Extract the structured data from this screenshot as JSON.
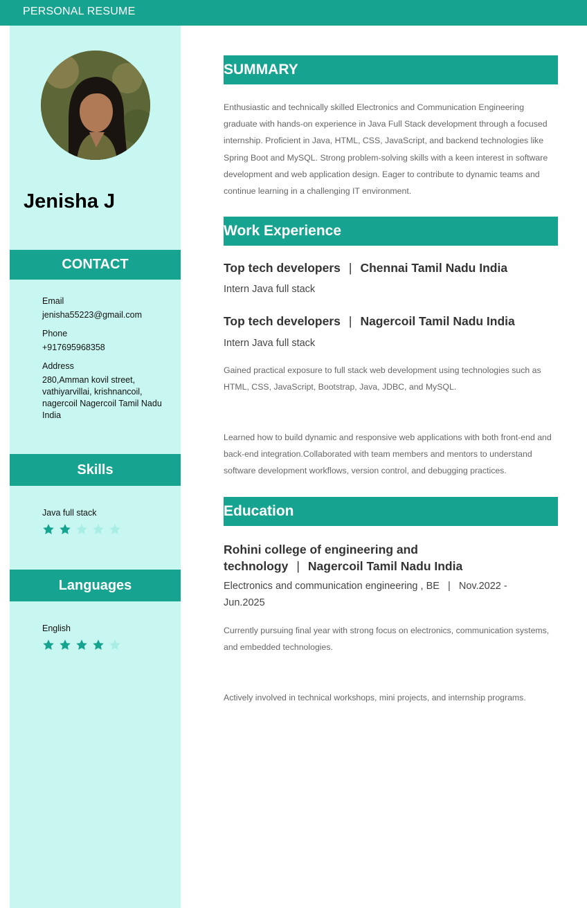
{
  "header": {
    "title": "PERSONAL RESUME"
  },
  "profile": {
    "name": "Jenisha J"
  },
  "contact": {
    "heading": "CONTACT",
    "email_label": "Email",
    "email": "jenisha55223@gmail.com",
    "phone_label": "Phone",
    "phone": "+917695968358",
    "address_label": "Address",
    "address": "280,Amman kovil street, vathiyarvillai, krishnancoil, nagercoil Nagercoil Tamil Nadu India"
  },
  "skills": {
    "heading": "Skills",
    "items": [
      {
        "name": "Java full stack",
        "rating": 2,
        "max": 5
      }
    ]
  },
  "languages": {
    "heading": "Languages",
    "items": [
      {
        "name": "English",
        "rating": 4,
        "max": 5
      }
    ]
  },
  "summary": {
    "heading": "SUMMARY",
    "text": "Enthusiastic and technically skilled Electronics and Communication Engineering graduate with hands-on experience in Java Full Stack development through a focused internship. Proficient in Java, HTML, CSS, JavaScript, and backend technologies like Spring Boot and MySQL. Strong problem-solving skills with a keen interest in software development and web application design. Eager to contribute to dynamic teams and continue learning in a challenging IT environment."
  },
  "work": {
    "heading": "Work Experience",
    "jobs": [
      {
        "company": "Top tech developers",
        "separator": "|",
        "location": "Chennai Tamil Nadu India",
        "role": "Intern Java full stack"
      },
      {
        "company": "Top tech developers",
        "separator": "|",
        "location": "Nagercoil Tamil Nadu India",
        "role": "Intern Java full stack"
      }
    ],
    "desc1": "Gained practical exposure to full stack web development using technologies such as HTML, CSS, JavaScript, Bootstrap, Java, JDBC, and MySQL.",
    "desc2": "Learned how to build dynamic and responsive web applications with both front-end and back-end integration.Collaborated with team members and mentors to understand software development workflows, version control, and debugging practices."
  },
  "education": {
    "heading": "Education",
    "school": "Rohini college of engineering and technology",
    "separator": "|",
    "location": "Nagercoil Tamil Nadu India",
    "degree_line": "Electronics and communication engineering , BE   |   Nov.2022 - Jun.2025",
    "desc1": "Currently pursuing final year with strong focus on electronics, communication systems, and embedded technologies.",
    "desc2": "Actively involved in technical workshops, mini projects, and internship programs."
  },
  "colors": {
    "accent": "#16a390",
    "sidebar_bg": "#c8f6f1",
    "star_on": "#16a390",
    "star_off": "#a9eee5"
  },
  "icons": {
    "rating_star": "star-icon"
  }
}
